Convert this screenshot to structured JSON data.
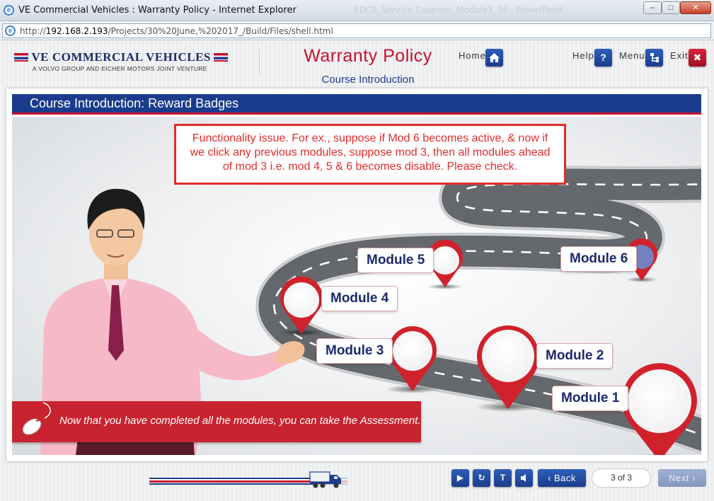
{
  "browser": {
    "window_title": "VE Commercial Vehicles : Warranty Policy - Internet Explorer",
    "background_window_title": "EDCS_Service Coupons_Module3_36 - PowerPoint",
    "url_prefix": "http://",
    "url_host": "192.168.2.193",
    "url_path": "/Projects/30%20June,%202017_/Build/Files/shell.html",
    "controls": {
      "minimize": "–",
      "maximize": "□",
      "close": "✕"
    }
  },
  "header": {
    "logo_name": "VE COMMERCIAL VEHICLES",
    "logo_tagline": "A VOLVO GROUP AND EICHER MOTORS JOINT VENTURE",
    "course_title": "Warranty Policy",
    "course_subtitle": "Course Introduction",
    "nav": {
      "home_label": "Home",
      "help_label": "Help",
      "menu_label": "Menu",
      "exit_label": "Exit",
      "help_icon": "?",
      "home_icon": "home-icon",
      "menu_icon": "menu-tree-icon",
      "exit_icon": "close-icon"
    }
  },
  "slide": {
    "title": "Course Introduction: Reward Badges",
    "review_comment": "Functionality issue. For ex., suppose if Mod 6 becomes active, & now if we click any previous modules, suppose mod 3, then all modules ahead of mod 3 i.e. mod 4, 5 & 6 becomes disable. Please check.",
    "modules": [
      {
        "label": "Module 1"
      },
      {
        "label": "Module 2"
      },
      {
        "label": "Module 3"
      },
      {
        "label": "Module 4"
      },
      {
        "label": "Module 5"
      },
      {
        "label": "Module 6",
        "active": true
      }
    ],
    "banner_text": "Now that you have completed all the modules, you can take the Assessment."
  },
  "footer": {
    "progress": 0.84,
    "back_label": "Back",
    "page_indicator": "3 of 3",
    "next_label": "Next"
  },
  "colors": {
    "brand_blue": "#1b3c8c",
    "brand_red": "#c8102e",
    "pin_red": "#d0222c",
    "active_pin": "#7381c0"
  }
}
